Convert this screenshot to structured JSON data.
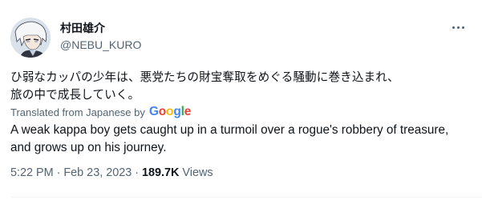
{
  "author": {
    "display_name": "村田雄介",
    "handle": "@NEBU_KURO"
  },
  "tweet": {
    "original_text_line1": "ひ弱なカッパの少年は、悪党たちの財宝奪取をめぐる騒動に巻き込まれ、",
    "original_text_line2": "旅の中で成長していく。",
    "translation_label": "Translated from Japanese by",
    "translation_provider": "Google",
    "translated_text": "A weak kappa boy gets caught up in a turmoil over a rogue's robbery of treasure, and grows up on his journey."
  },
  "meta": {
    "time": "5:22 PM",
    "date": "Feb 23, 2023",
    "separator": "·",
    "views_count": "189.7K",
    "views_label": "Views"
  },
  "icons": {
    "more": "more-horizontal-icon"
  },
  "colors": {
    "text_primary": "#0f1419",
    "text_secondary": "#536471",
    "google_blue": "#4285F4",
    "google_red": "#EA4335",
    "google_yellow": "#FBBC05",
    "google_green": "#34A853"
  }
}
